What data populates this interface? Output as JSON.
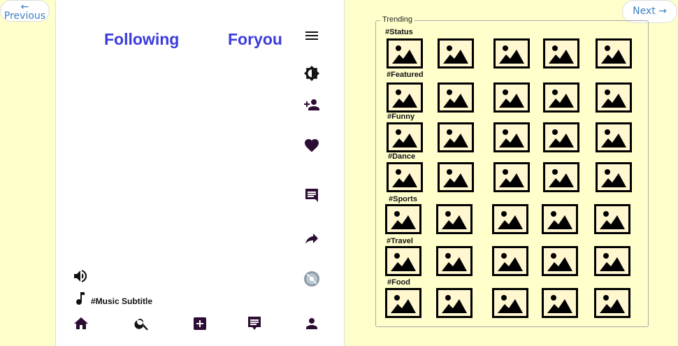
{
  "nav": {
    "previous_label": "← Previous",
    "next_label": "Next →"
  },
  "feed": {
    "tab_following": "Following",
    "tab_foryou": "Foryou"
  },
  "music": {
    "subtitle": "#Music Subtitle"
  },
  "trending": {
    "legend": "Trending",
    "categories": [
      "#Status",
      "#Featured",
      "#Funny",
      "#Dance",
      "#Sports",
      "#Travel",
      "#Food"
    ]
  },
  "colors": {
    "accent": "#3b3bdd",
    "icon": "#2d0d33",
    "background": "#ffffcc"
  },
  "icons": {
    "rail": [
      "menu-icon",
      "brightness-icon",
      "person-add-icon",
      "heart-icon",
      "comment-icon",
      "share-icon",
      "disc-icon"
    ],
    "bottom": [
      "home-icon",
      "search-icon",
      "add-box-icon",
      "feed-icon",
      "person-icon"
    ],
    "thumbnail": "image-placeholder-icon"
  }
}
